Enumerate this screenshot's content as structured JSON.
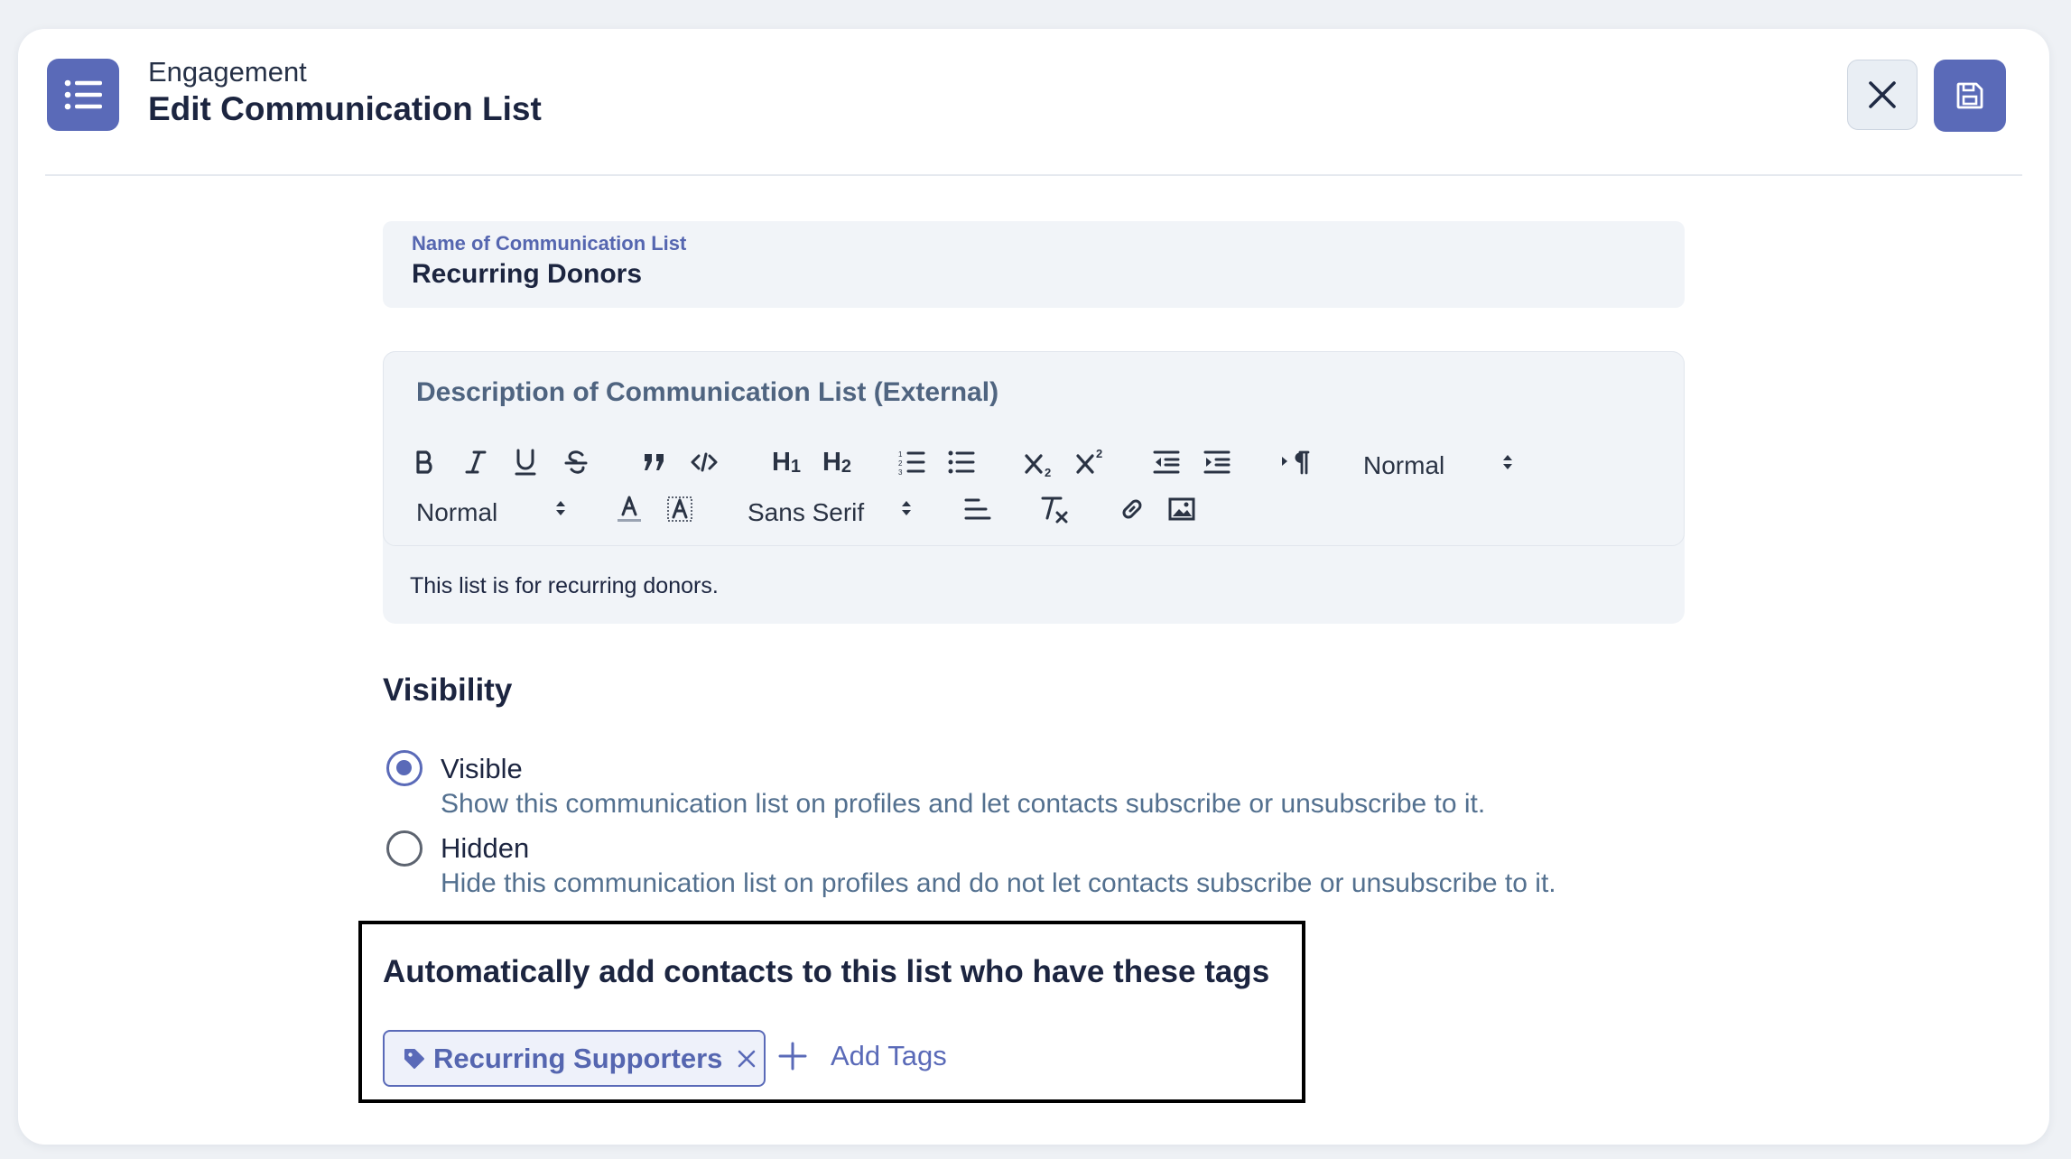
{
  "header": {
    "breadcrumb": "Engagement",
    "title": "Edit Communication List",
    "icon": "list-icon",
    "close_icon": "close-icon",
    "save_icon": "save-icon"
  },
  "name_field": {
    "label": "Name of Communication List",
    "value": "Recurring Donors"
  },
  "description": {
    "label": "Description of Communication List (External)",
    "toolbar": {
      "header_select": "Normal",
      "size_select": "Normal",
      "font_select": "Sans Serif",
      "h1": "H",
      "h1_sub": "1",
      "h2": "H",
      "h2_sub": "2",
      "buttons": [
        "bold-icon",
        "italic-icon",
        "underline-icon",
        "strike-icon",
        "blockquote-icon",
        "code-block-icon",
        "h1-icon",
        "h2-icon",
        "ordered-list-icon",
        "bullet-list-icon",
        "subscript-icon",
        "superscript-icon",
        "outdent-icon",
        "indent-icon",
        "text-direction-icon",
        "text-color-icon",
        "background-color-icon",
        "align-icon",
        "clear-format-icon",
        "link-icon",
        "image-icon"
      ]
    },
    "content": "This list is for recurring donors."
  },
  "visibility": {
    "title": "Visibility",
    "options": [
      {
        "label": "Visible",
        "description": "Show this communication list on profiles and let contacts subscribe or unsubscribe to it.",
        "selected": true
      },
      {
        "label": "Hidden",
        "description": "Hide this communication list on profiles and do not let contacts subscribe or unsubscribe to it.",
        "selected": false
      }
    ]
  },
  "tags": {
    "title": "Automatically add contacts to this list who have these tags",
    "items": [
      {
        "label": "Recurring Supporters",
        "icon": "tag-icon"
      }
    ],
    "add_label": "Add Tags"
  },
  "colors": {
    "accent": "#5a6ab8",
    "text": "#1c2540",
    "muted": "#53708f"
  }
}
